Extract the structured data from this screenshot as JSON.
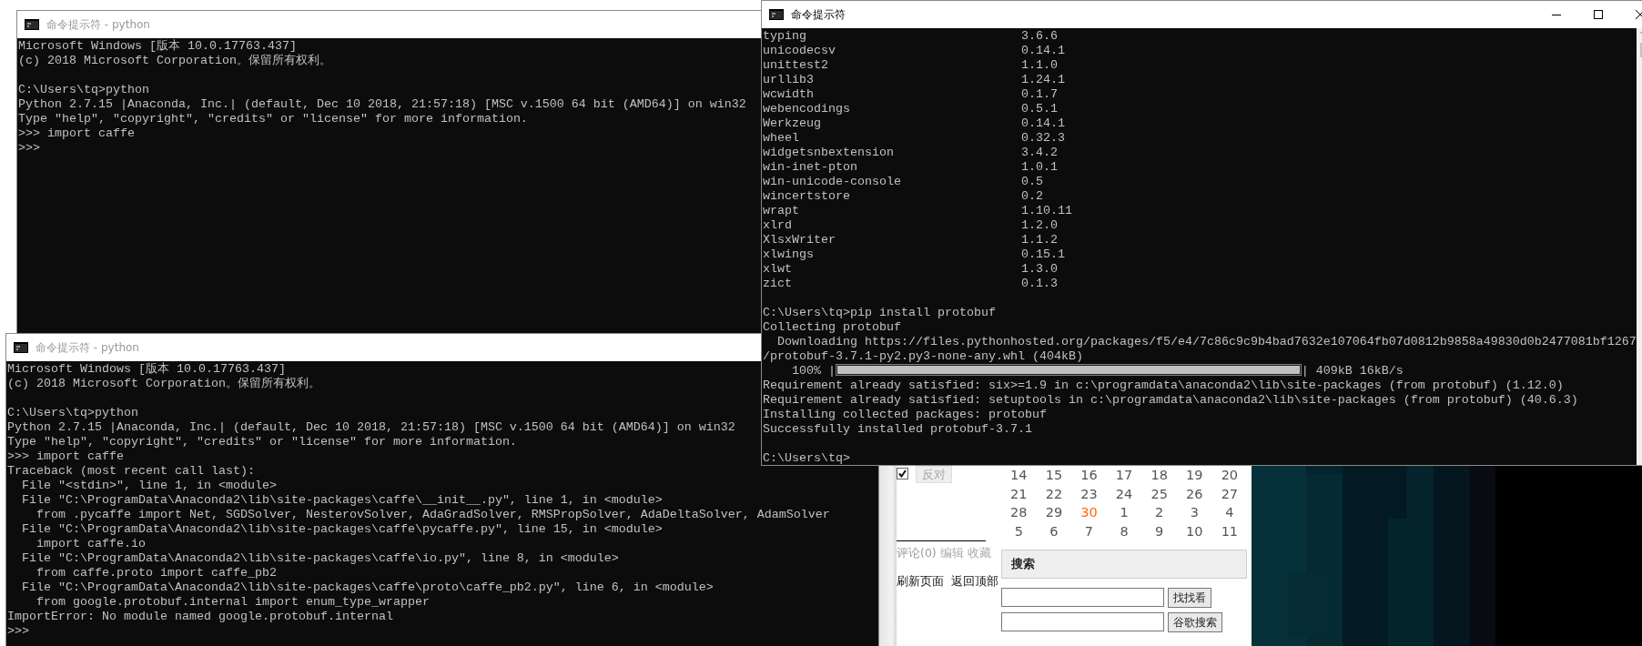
{
  "windows": [
    {
      "title": "命令提示符 - python",
      "active": false,
      "lines": [
        {
          "kind": "text",
          "text": "Microsoft Windows [版本 10.0.17763.437]"
        },
        {
          "kind": "text",
          "text": "(c) 2018 Microsoft Corporation。保留所有权利。"
        },
        {
          "kind": "blank"
        },
        {
          "kind": "text",
          "text": "C:\\Users\\tq>python"
        },
        {
          "kind": "text",
          "text": "Python 2.7.15 |Anaconda, Inc.| (default, Dec 10 2018, 21:57:18) [MSC v.1500 64 bit (AMD64)] on win32"
        },
        {
          "kind": "text",
          "text": "Type \"help\", \"copyright\", \"credits\" or \"license\" for more information."
        },
        {
          "kind": "text",
          "text": ">>> import caffe"
        },
        {
          "kind": "text",
          "text": ">>>"
        }
      ]
    },
    {
      "title": "命令提示符 - python",
      "active": false,
      "lines": [
        {
          "kind": "text",
          "text": "Microsoft Windows [版本 10.0.17763.437]"
        },
        {
          "kind": "text",
          "text": "(c) 2018 Microsoft Corporation。保留所有权利。"
        },
        {
          "kind": "blank"
        },
        {
          "kind": "text",
          "text": "C:\\Users\\tq>python"
        },
        {
          "kind": "text",
          "text": "Python 2.7.15 |Anaconda, Inc.| (default, Dec 10 2018, 21:57:18) [MSC v.1500 64 bit (AMD64)] on win32"
        },
        {
          "kind": "text",
          "text": "Type \"help\", \"copyright\", \"credits\" or \"license\" for more information."
        },
        {
          "kind": "text",
          "text": ">>> import caffe"
        },
        {
          "kind": "text",
          "text": "Traceback (most recent call last):"
        },
        {
          "kind": "text",
          "text": "  File \"<stdin>\", line 1, in <module>"
        },
        {
          "kind": "text",
          "text": "  File \"C:\\ProgramData\\Anaconda2\\lib\\site-packages\\caffe\\__init__.py\", line 1, in <module>"
        },
        {
          "kind": "text",
          "text": "    from .pycaffe import Net, SGDSolver, NesterovSolver, AdaGradSolver, RMSPropSolver, AdaDeltaSolver, AdamSolver"
        },
        {
          "kind": "text",
          "text": "  File \"C:\\ProgramData\\Anaconda2\\lib\\site-packages\\caffe\\pycaffe.py\", line 15, in <module>"
        },
        {
          "kind": "text",
          "text": "    import caffe.io"
        },
        {
          "kind": "text",
          "text": "  File \"C:\\ProgramData\\Anaconda2\\lib\\site-packages\\caffe\\io.py\", line 8, in <module>"
        },
        {
          "kind": "text",
          "text": "    from caffe.proto import caffe_pb2"
        },
        {
          "kind": "text",
          "text": "  File \"C:\\ProgramData\\Anaconda2\\lib\\site-packages\\caffe\\proto\\caffe_pb2.py\", line 6, in <module>"
        },
        {
          "kind": "text",
          "text": "    from google.protobuf.internal import enum_type_wrapper"
        },
        {
          "kind": "text",
          "text": "ImportError: No module named google.protobuf.internal"
        },
        {
          "kind": "text",
          "text": ">>>"
        }
      ]
    },
    {
      "title": "命令提示符",
      "active": true,
      "lines": [
        {
          "kind": "package",
          "name": "typing",
          "version": "3.6.6"
        },
        {
          "kind": "package",
          "name": "unicodecsv",
          "version": "0.14.1"
        },
        {
          "kind": "package",
          "name": "unittest2",
          "version": "1.1.0"
        },
        {
          "kind": "package",
          "name": "urllib3",
          "version": "1.24.1"
        },
        {
          "kind": "package",
          "name": "wcwidth",
          "version": "0.1.7"
        },
        {
          "kind": "package",
          "name": "webencodings",
          "version": "0.5.1"
        },
        {
          "kind": "package",
          "name": "Werkzeug",
          "version": "0.14.1"
        },
        {
          "kind": "package",
          "name": "wheel",
          "version": "0.32.3"
        },
        {
          "kind": "package",
          "name": "widgetsnbextension",
          "version": "3.4.2"
        },
        {
          "kind": "package",
          "name": "win-inet-pton",
          "version": "1.0.1"
        },
        {
          "kind": "package",
          "name": "win-unicode-console",
          "version": "0.5"
        },
        {
          "kind": "package",
          "name": "wincertstore",
          "version": "0.2"
        },
        {
          "kind": "package",
          "name": "wrapt",
          "version": "1.10.11"
        },
        {
          "kind": "package",
          "name": "xlrd",
          "version": "1.2.0"
        },
        {
          "kind": "package",
          "name": "XlsxWriter",
          "version": "1.1.2"
        },
        {
          "kind": "package",
          "name": "xlwings",
          "version": "0.15.1"
        },
        {
          "kind": "package",
          "name": "xlwt",
          "version": "1.3.0"
        },
        {
          "kind": "package",
          "name": "zict",
          "version": "0.1.3"
        },
        {
          "kind": "blank"
        },
        {
          "kind": "text",
          "text": "C:\\Users\\tq>pip install protobuf"
        },
        {
          "kind": "text",
          "text": "Collecting protobuf"
        },
        {
          "kind": "text",
          "text": "  Downloading https://files.pythonhosted.org/packages/f5/e4/7c86c9c9b4bad7632e107064fb07d0812b9858a49830d0b2477081bf1267"
        },
        {
          "kind": "text",
          "text": "/protobuf-3.7.1-py2.py3-none-any.whl (404kB)"
        },
        {
          "kind": "progress",
          "lead": "    100% |",
          "level": 1,
          "tail": "| 409kB 16kB/s"
        },
        {
          "kind": "text",
          "text": "Requirement already satisfied: six>=1.9 in c:\\programdata\\anaconda2\\lib\\site-packages (from protobuf) (1.12.0)"
        },
        {
          "kind": "text",
          "text": "Requirement already satisfied: setuptools in c:\\programdata\\anaconda2\\lib\\site-packages (from protobuf) (40.6.3)"
        },
        {
          "kind": "text",
          "text": "Installing collected packages: protobuf"
        },
        {
          "kind": "text",
          "text": "Successfully installed protobuf-3.7.1"
        },
        {
          "kind": "blank"
        },
        {
          "kind": "text",
          "text": "C:\\Users\\tq>"
        }
      ]
    }
  ],
  "web_page": {
    "vote": {
      "checked": true,
      "oppose_button": "反对"
    },
    "calendar": {
      "weeks": [
        [
          {
            "day": "14",
            "today": false
          },
          {
            "day": "15",
            "today": false
          },
          {
            "day": "16",
            "today": false
          },
          {
            "day": "17",
            "today": false
          },
          {
            "day": "18",
            "today": false
          },
          {
            "day": "19",
            "today": false
          },
          {
            "day": "20",
            "today": false
          }
        ],
        [
          {
            "day": "21",
            "today": false
          },
          {
            "day": "22",
            "today": false
          },
          {
            "day": "23",
            "today": false
          },
          {
            "day": "24",
            "today": false
          },
          {
            "day": "25",
            "today": false
          },
          {
            "day": "26",
            "today": false
          },
          {
            "day": "27",
            "today": false
          }
        ],
        [
          {
            "day": "28",
            "today": false
          },
          {
            "day": "29",
            "today": false
          },
          {
            "day": "30",
            "today": true
          },
          {
            "day": "1",
            "today": false
          },
          {
            "day": "2",
            "today": false
          },
          {
            "day": "3",
            "today": false
          },
          {
            "day": "4",
            "today": false
          }
        ],
        [
          {
            "day": "5",
            "today": false
          },
          {
            "day": "6",
            "today": false
          },
          {
            "day": "7",
            "today": false
          },
          {
            "day": "8",
            "today": false
          },
          {
            "day": "9",
            "today": false
          },
          {
            "day": "10",
            "today": false
          },
          {
            "day": "11",
            "today": false
          }
        ]
      ]
    },
    "post_links": [
      "评论(0)",
      "编辑",
      "收藏"
    ],
    "page_links": [
      "刷新页面",
      "返回顶部"
    ],
    "search": {
      "title": "搜索",
      "buttons": [
        "找找看",
        "谷歌搜索"
      ]
    }
  }
}
